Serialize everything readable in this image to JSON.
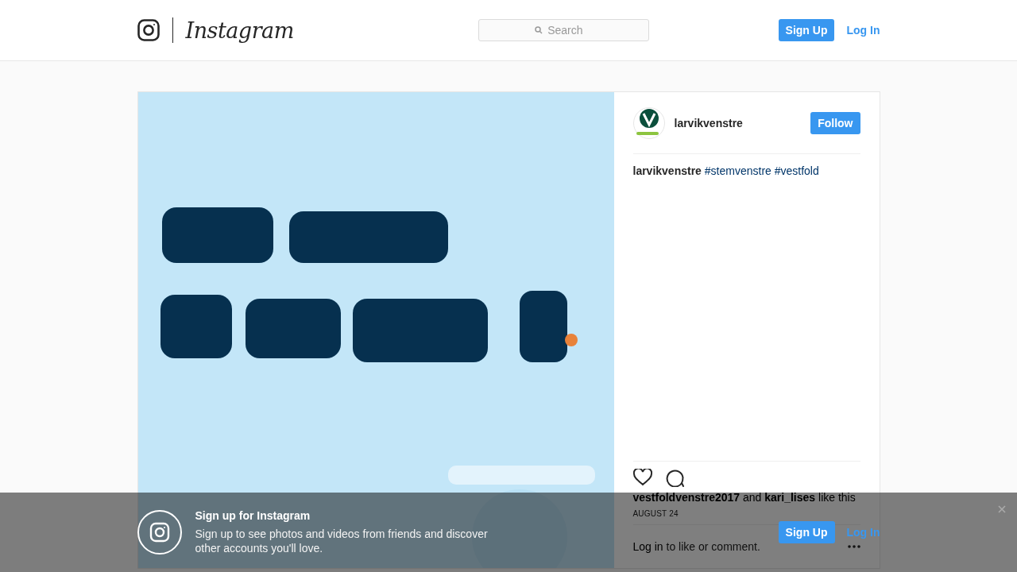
{
  "header": {
    "logo_text": "Instagram",
    "search": {
      "placeholder": "Search"
    },
    "buttons": [
      {
        "label": "Sign Up",
        "kind": "primary"
      },
      {
        "label": "Log In",
        "kind": "link"
      }
    ]
  },
  "post": {
    "author": "larvikvenstre",
    "follow": "Follow",
    "caption": {
      "author": "larvikvenstre",
      "hashtags": [
        "#stemvenstre",
        "#vestfold"
      ]
    },
    "likes": "**vestfoldvenstre2017** and **kari_lises** like this",
    "date": "AUGUST 24",
    "login_prompt": {
      "link": "Log in",
      "text": "to like or comment."
    }
  },
  "banner": {
    "title": "Sign up for Instagram",
    "text": "Sign up to see photos and videos from friends and discover other accounts you'll love.",
    "buttons": [
      {
        "label": "Sign Up",
        "kind": "primary"
      },
      {
        "label": "Log In",
        "kind": "link"
      }
    ]
  }
}
